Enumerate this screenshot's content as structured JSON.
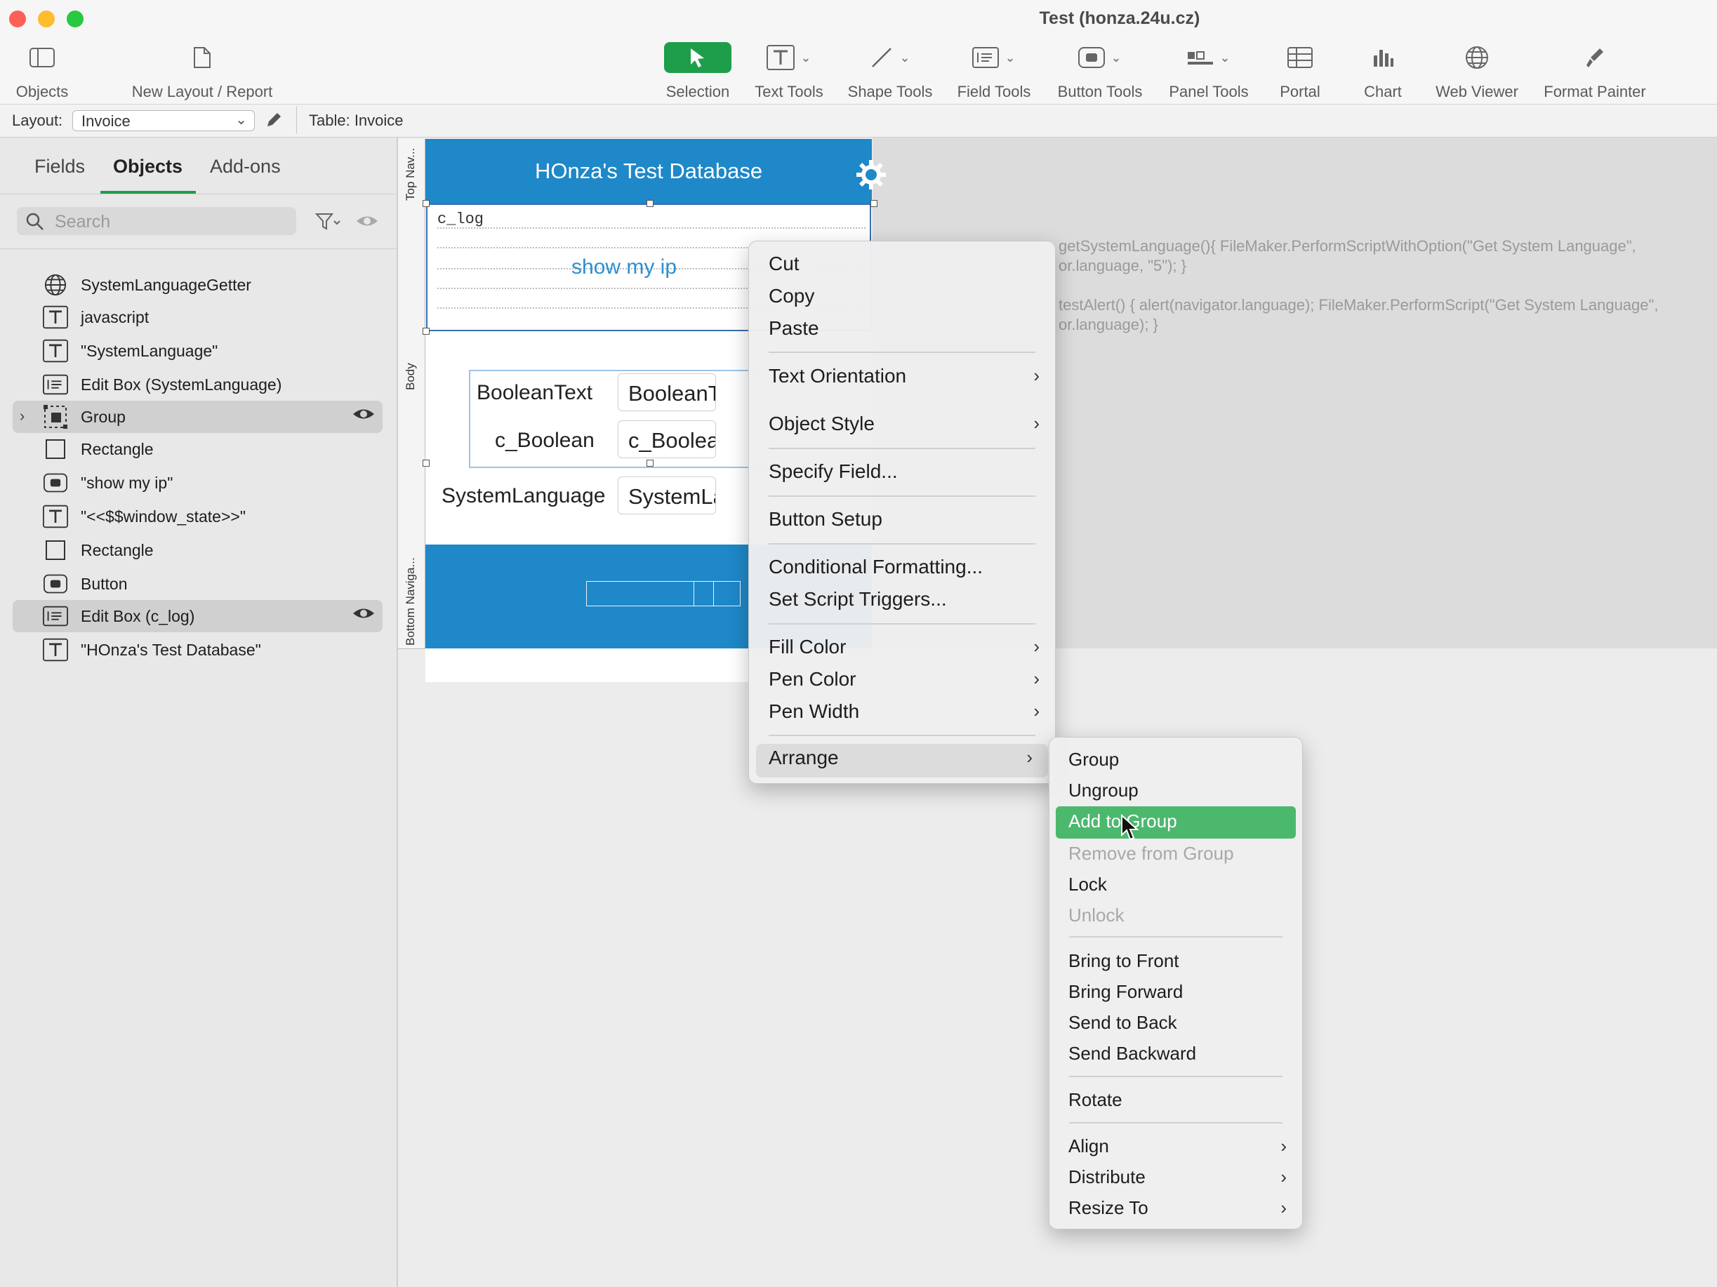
{
  "window": {
    "title": "Test (honza.24u.cz)"
  },
  "toolbar": {
    "objects": "Objects",
    "new_layout": "New Layout / Report",
    "selection": "Selection",
    "text_tools": "Text Tools",
    "shape_tools": "Shape Tools",
    "field_tools": "Field Tools",
    "button_tools": "Button Tools",
    "panel_tools": "Panel Tools",
    "portal": "Portal",
    "chart": "Chart",
    "web_viewer": "Web Viewer",
    "format_painter": "Format Painter"
  },
  "layout_bar": {
    "layout_label": "Layout:",
    "layout_value": "Invoice",
    "table_label": "Table: Invoice"
  },
  "sidebar": {
    "tabs": [
      "Fields",
      "Objects",
      "Add-ons"
    ],
    "active_tab": "Objects",
    "search_placeholder": "Search",
    "objects": [
      {
        "label": "SystemLanguageGetter",
        "icon": "globe-icon"
      },
      {
        "label": "javascript",
        "icon": "text-icon"
      },
      {
        "label": "\"SystemLanguage\"",
        "icon": "text-icon"
      },
      {
        "label": "Edit Box (SystemLanguage)",
        "icon": "field-icon"
      },
      {
        "label": "Group",
        "icon": "group-icon",
        "highlighted": true,
        "visible_eye": true
      },
      {
        "label": "Rectangle",
        "icon": "rectangle-icon"
      },
      {
        "label": "\"show my ip\"",
        "icon": "button-icon"
      },
      {
        "label": "\"<<$$window_state>>\"",
        "icon": "text-icon"
      },
      {
        "label": "Rectangle",
        "icon": "rectangle-icon"
      },
      {
        "label": "Button",
        "icon": "button-icon"
      },
      {
        "label": "Edit Box (c_log)",
        "icon": "field-icon",
        "highlighted": true,
        "visible_eye": true
      },
      {
        "label": "\"HOnza's Test Database\"",
        "icon": "text-icon"
      }
    ]
  },
  "canvas": {
    "parts": {
      "top_nav": "Top Nav...",
      "body": "Body",
      "bottom_nav": "Bottom Naviga..."
    },
    "db_title": "HOnza's Test Database",
    "clog_label": "c_log",
    "show_ip": "show my ip",
    "fields": {
      "boolean_text_label": "BooleanText",
      "boolean_text_value": "BooleanText",
      "c_boolean_label": "c_Boolean",
      "c_boolean_value": "c_Boolean",
      "system_language_label": "SystemLanguage",
      "system_language_value": "SystemLanguage"
    },
    "code_lines": [
      "getSystemLanguage(){ FileMaker.PerformScriptWithOption(\"Get System Language\",",
      "or.language, \"5\"); }",
      "testAlert() { alert(navigator.language); FileMaker.PerformScript(\"Get System Language\",",
      "or.language); }"
    ]
  },
  "context_menu": {
    "cut": "Cut",
    "copy": "Copy",
    "paste": "Paste",
    "text_orientation": "Text Orientation",
    "object_style": "Object Style",
    "specify_field": "Specify Field...",
    "button_setup": "Button Setup",
    "conditional_formatting": "Conditional Formatting...",
    "set_script_triggers": "Set Script Triggers...",
    "fill_color": "Fill Color",
    "pen_color": "Pen Color",
    "pen_width": "Pen Width",
    "arrange": "Arrange"
  },
  "arrange_menu": {
    "group": "Group",
    "ungroup": "Ungroup",
    "add_to_group": "Add to Group",
    "remove_from_group": "Remove from Group",
    "lock": "Lock",
    "unlock": "Unlock",
    "bring_to_front": "Bring to Front",
    "bring_forward": "Bring Forward",
    "send_to_back": "Send to Back",
    "send_backward": "Send Backward",
    "rotate": "Rotate",
    "align": "Align",
    "distribute": "Distribute",
    "resize_to": "Resize To"
  },
  "colors": {
    "accent_green": "#1e9e4a",
    "menu_highlight": "#4cb86e",
    "header_blue": "#1e88c8"
  }
}
